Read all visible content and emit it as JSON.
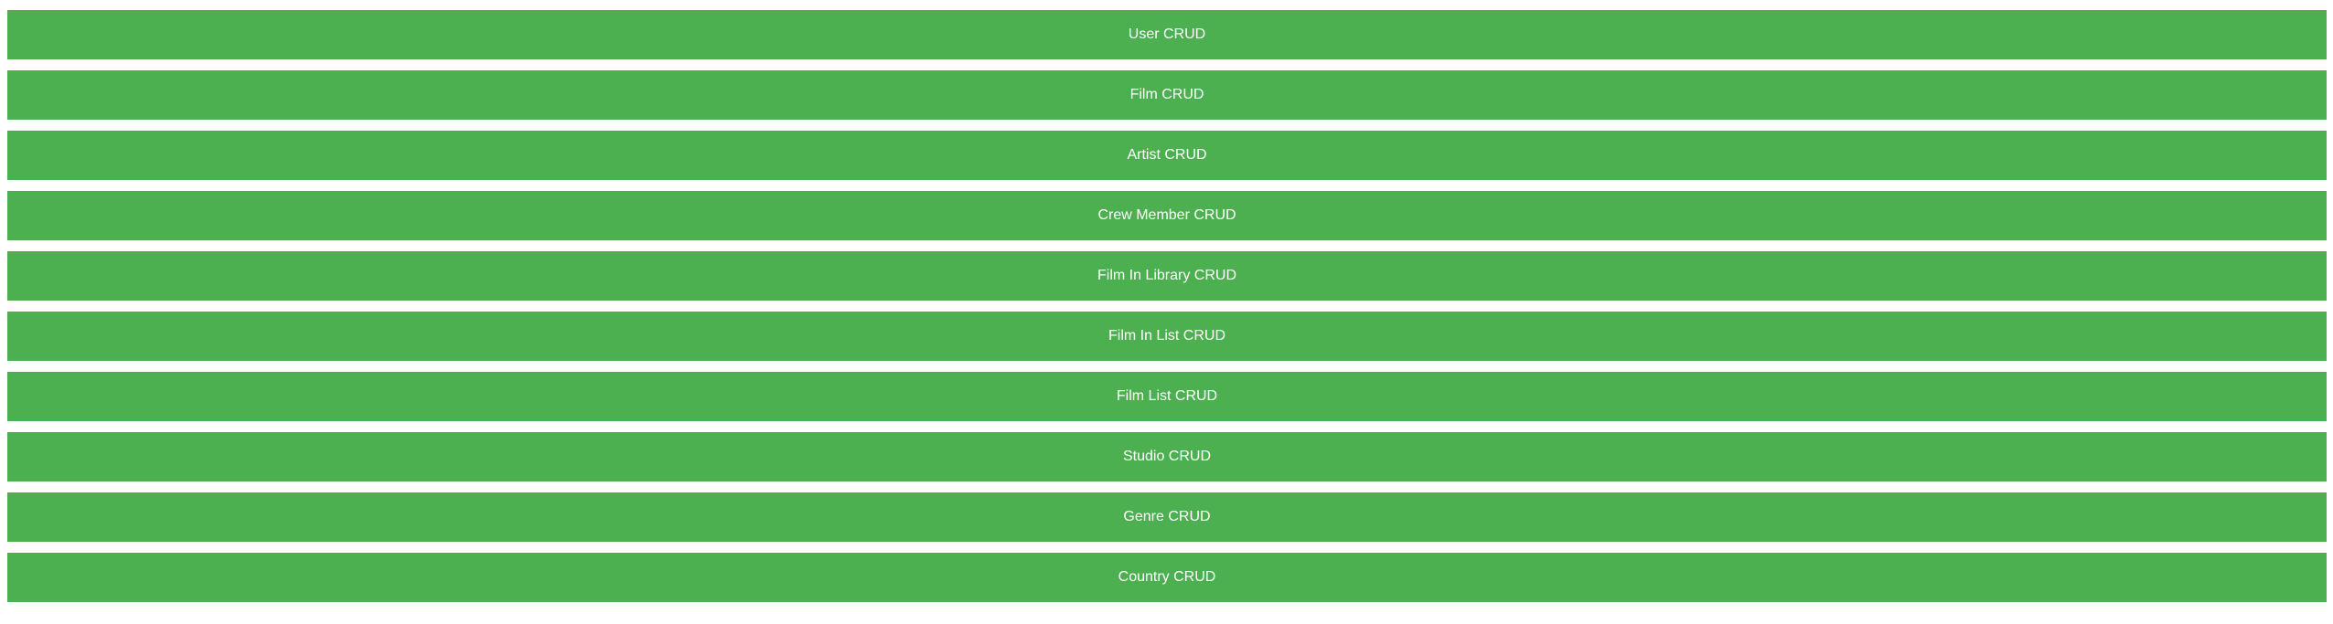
{
  "theme": {
    "button_color": "#4CAF50",
    "text_color": "#FFFFFF",
    "background": "#FFFFFF"
  },
  "menu": {
    "buttons": [
      {
        "label": "User CRUD"
      },
      {
        "label": "Film CRUD"
      },
      {
        "label": "Artist CRUD"
      },
      {
        "label": "Crew Member CRUD"
      },
      {
        "label": "Film In Library CRUD"
      },
      {
        "label": "Film In List CRUD"
      },
      {
        "label": "Film List CRUD"
      },
      {
        "label": "Studio CRUD"
      },
      {
        "label": "Genre CRUD"
      },
      {
        "label": "Country CRUD"
      }
    ]
  }
}
